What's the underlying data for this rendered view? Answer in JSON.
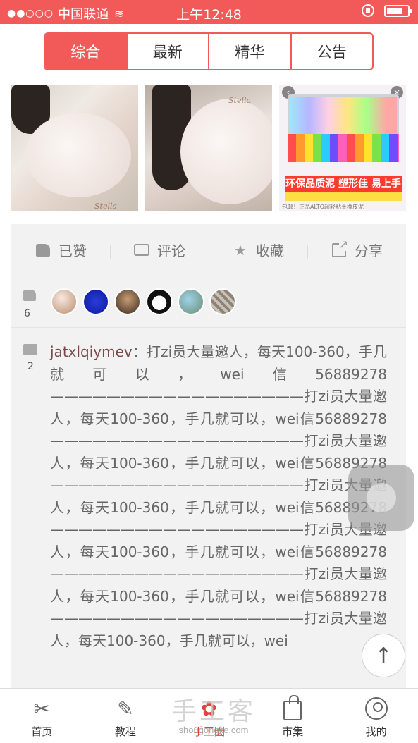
{
  "status_bar": {
    "carrier": "中国联通",
    "time": "上午12:48"
  },
  "tabs": [
    {
      "label": "综合",
      "active": true
    },
    {
      "label": "最新",
      "active": false
    },
    {
      "label": "精华",
      "active": false
    },
    {
      "label": "公告",
      "active": false
    }
  ],
  "images": {
    "watermark_1": "Stella",
    "watermark_2": "Stella",
    "ad_headline": "环保品质泥 塑形佳 易上手",
    "ad_caption": "包邮！正品ALTO超轻粘土橡皮泥"
  },
  "actions": {
    "liked_label": "已赞",
    "comment_label": "评论",
    "favorite_label": "收藏",
    "share_label": "分享"
  },
  "likes": {
    "count": "6"
  },
  "comments": {
    "count": "2",
    "username": "jatxlqiymev",
    "separator": "：",
    "text": "打zi员大量邀人，每天100-360，手几就可以，wei信56889278 ——————————————————打zi员大量邀人，每天100-360，手几就可以，wei信56889278 ——————————————————打zi员大量邀人，每天100-360，手几就可以，wei信56889278 ——————————————————打zi员大量邀人，每天100-360，手几就可以，wei信56889278 ——————————————————打zi员大量邀人，每天100-360，手几就可以，wei信56889278 ——————————————————打zi员大量邀人，每天100-360，手几就可以，wei信56889278 ——————————————————打zi员大量邀人，每天100-360，手几就可以，wei"
  },
  "bottom_nav": [
    {
      "label": "首页",
      "icon": "scissors-icon",
      "active": false
    },
    {
      "label": "教程",
      "icon": "pencil-ruler-icon",
      "active": false
    },
    {
      "label": "手工圈",
      "icon": "flower-icon",
      "active": true
    },
    {
      "label": "市集",
      "icon": "shopping-bag-icon",
      "active": false
    },
    {
      "label": "我的",
      "icon": "user-icon",
      "active": false
    }
  ],
  "watermark": {
    "main": "手工客",
    "sub": "shougongke.com"
  },
  "colors": {
    "accent": "#f25a5a",
    "nav_active": "#e0433f"
  }
}
